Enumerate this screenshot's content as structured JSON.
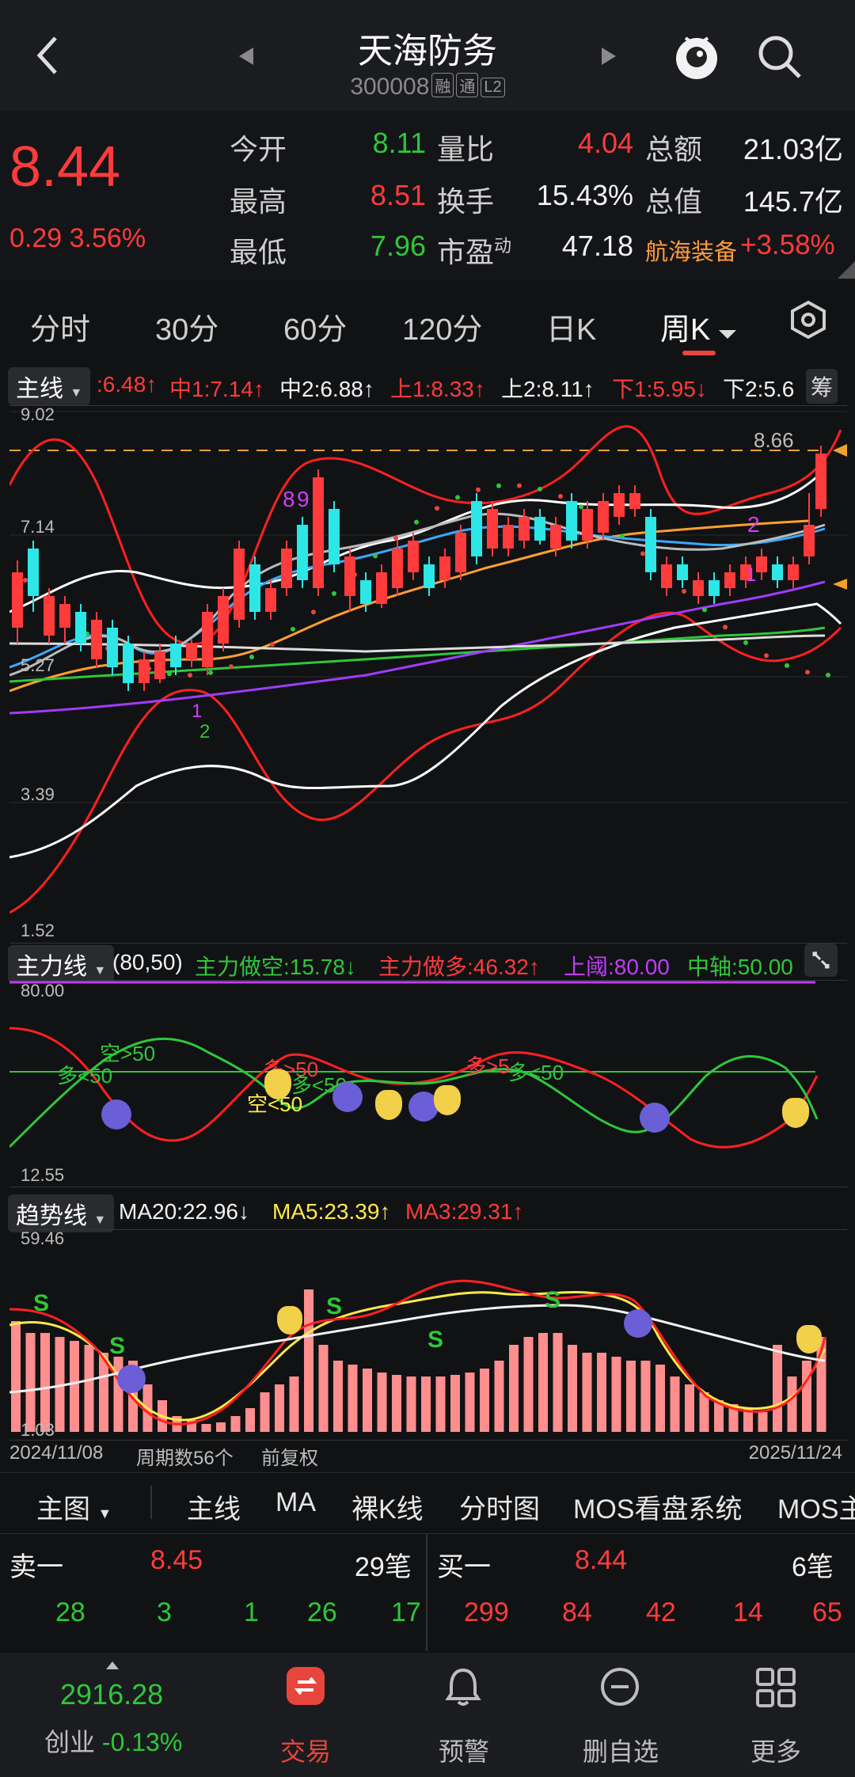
{
  "header": {
    "title": "天海防务",
    "code": "300008",
    "tags": [
      "融",
      "通",
      "L2"
    ]
  },
  "quote": {
    "price": "8.44",
    "change": "0.29",
    "change_pct": "3.56%",
    "rows": [
      {
        "l1": "今开",
        "v1": "8.11",
        "l2": "量比",
        "v2": "4.04",
        "l3": "总额",
        "v3": "21.03亿"
      },
      {
        "l1": "最高",
        "v1": "8.51",
        "l2": "换手",
        "v2": "15.43%",
        "l3": "总值",
        "v3": "145.7亿"
      },
      {
        "l1": "最低",
        "v1": "7.96",
        "l2": "市盈",
        "v2": "47.18",
        "l3": "航海装备",
        "v3": "+3.58%"
      }
    ],
    "pe_sup": "动"
  },
  "tabs": [
    "分时",
    "30分",
    "60分",
    "120分",
    "日K",
    "周K"
  ],
  "active_tab": "周K",
  "main_indicator": {
    "label": "主线",
    "items": [
      ":6.48↑",
      "中1:7.14↑",
      "中2:6.88↑",
      "上1:8.33↑",
      "上2:8.11↑",
      "下1:5.95↓",
      "下2:5.6"
    ],
    "badge": "筹",
    "axis": [
      "9.02",
      "7.14",
      "5.27",
      "3.39",
      "1.52"
    ],
    "marker_price": "8.66",
    "annotations": [
      "8",
      "9",
      "2",
      "1",
      "2",
      "1"
    ]
  },
  "main_force": {
    "label": "主力线",
    "params": "(80,50)",
    "short": "主力做空:15.78↓",
    "long": "主力做多:46.32↑",
    "upper": "上阈:80.00",
    "mid": "中轴:50.00",
    "axis": [
      "80.00",
      "12.55"
    ],
    "notes": [
      "空>50",
      "多<50",
      "多>50",
      "多<50",
      "空<50",
      "多>5",
      "多<50"
    ]
  },
  "trend": {
    "label": "趋势线",
    "ma20": "MA20:22.96↓",
    "ma5": "MA5:23.39↑",
    "ma3": "MA3:29.31↑",
    "axis": [
      "59.46",
      "1.03"
    ],
    "s_marks": [
      "S",
      "S",
      "S",
      "S",
      "S"
    ]
  },
  "footer_axis": {
    "start": "2024/11/08",
    "count": "周期数56个",
    "adjust": "前复权",
    "end": "2025/11/24"
  },
  "tools": [
    "主图",
    "主线",
    "MA",
    "裸K线",
    "分时图",
    "MOS看盘系统",
    "MOS主"
  ],
  "order_book": {
    "sell_label": "卖一",
    "sell_price": "8.45",
    "sell_count": "29笔",
    "buy_label": "买一",
    "buy_price": "8.44",
    "buy_count": "6笔",
    "sell_qty": [
      "28",
      "3",
      "1",
      "26",
      "17"
    ],
    "buy_qty": [
      "299",
      "84",
      "42",
      "14",
      "65"
    ]
  },
  "nav": {
    "index_value": "2916.28",
    "index_name": "创业",
    "index_change": "-0.13%",
    "items": [
      "交易",
      "预警",
      "删自选",
      "更多"
    ]
  },
  "colors": {
    "up": "#ff3b3b",
    "down": "#2fc73a",
    "accent": "#e8453c",
    "dash": "#f0a030"
  }
}
